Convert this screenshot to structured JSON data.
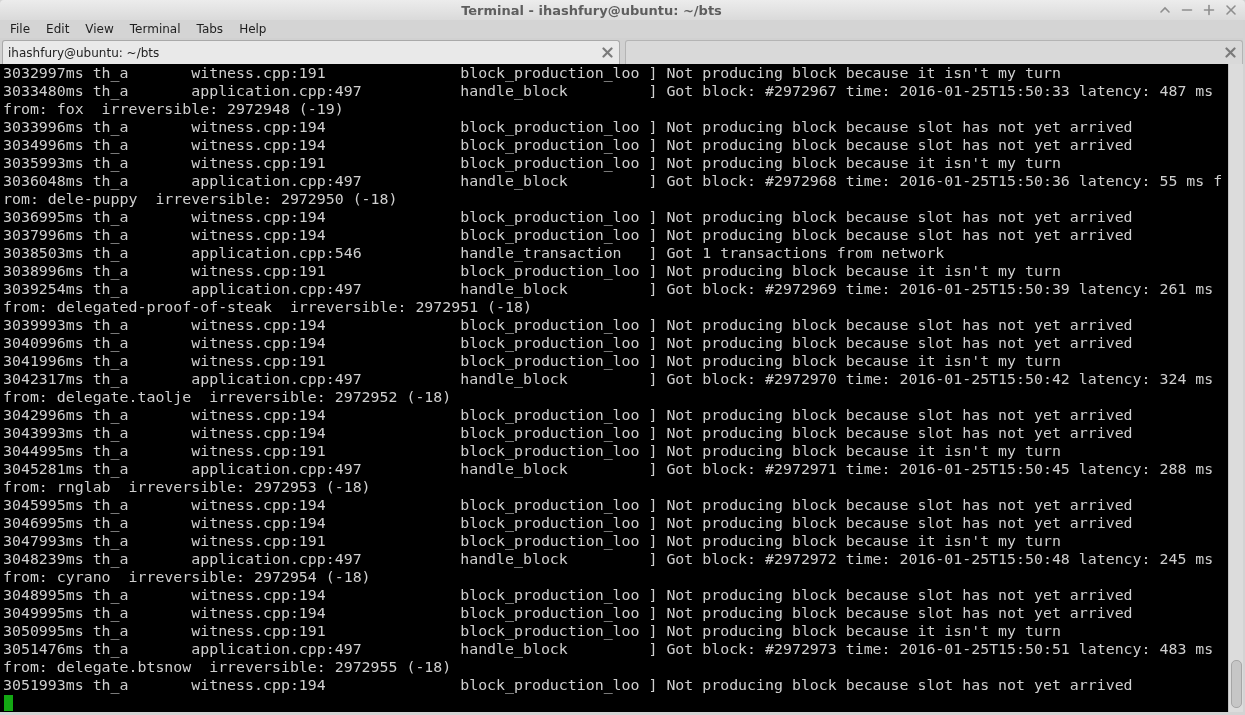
{
  "window": {
    "title": "Terminal - ihashfury@ubuntu: ~/bts"
  },
  "menu": [
    "File",
    "Edit",
    "View",
    "Terminal",
    "Tabs",
    "Help"
  ],
  "tabs": [
    {
      "label": "ihashfury@ubuntu: ~/bts",
      "selected": true
    },
    {
      "selected": false
    }
  ],
  "terminal": {
    "lines": [
      "3032997ms th_a       witness.cpp:191               block_production_loo ] Not producing block because it isn't my turn",
      "3033480ms th_a       application.cpp:497           handle_block         ] Got block: #2972967 time: 2016-01-25T15:50:33 latency: 487 ms",
      "from: fox  irreversible: 2972948 (-19)",
      "3033996ms th_a       witness.cpp:194               block_production_loo ] Not producing block because slot has not yet arrived",
      "3034996ms th_a       witness.cpp:194               block_production_loo ] Not producing block because slot has not yet arrived",
      "3035993ms th_a       witness.cpp:191               block_production_loo ] Not producing block because it isn't my turn",
      "3036048ms th_a       application.cpp:497           handle_block         ] Got block: #2972968 time: 2016-01-25T15:50:36 latency: 55 ms f",
      "rom: dele-puppy  irreversible: 2972950 (-18)",
      "3036995ms th_a       witness.cpp:194               block_production_loo ] Not producing block because slot has not yet arrived",
      "3037996ms th_a       witness.cpp:194               block_production_loo ] Not producing block because slot has not yet arrived",
      "3038503ms th_a       application.cpp:546           handle_transaction   ] Got 1 transactions from network",
      "3038996ms th_a       witness.cpp:191               block_production_loo ] Not producing block because it isn't my turn",
      "3039254ms th_a       application.cpp:497           handle_block         ] Got block: #2972969 time: 2016-01-25T15:50:39 latency: 261 ms",
      "from: delegated-proof-of-steak  irreversible: 2972951 (-18)",
      "3039993ms th_a       witness.cpp:194               block_production_loo ] Not producing block because slot has not yet arrived",
      "3040996ms th_a       witness.cpp:194               block_production_loo ] Not producing block because slot has not yet arrived",
      "3041996ms th_a       witness.cpp:191               block_production_loo ] Not producing block because it isn't my turn",
      "3042317ms th_a       application.cpp:497           handle_block         ] Got block: #2972970 time: 2016-01-25T15:50:42 latency: 324 ms",
      "from: delegate.taolje  irreversible: 2972952 (-18)",
      "3042996ms th_a       witness.cpp:194               block_production_loo ] Not producing block because slot has not yet arrived",
      "3043993ms th_a       witness.cpp:194               block_production_loo ] Not producing block because slot has not yet arrived",
      "3044995ms th_a       witness.cpp:191               block_production_loo ] Not producing block because it isn't my turn",
      "3045281ms th_a       application.cpp:497           handle_block         ] Got block: #2972971 time: 2016-01-25T15:50:45 latency: 288 ms",
      "from: rnglab  irreversible: 2972953 (-18)",
      "3045995ms th_a       witness.cpp:194               block_production_loo ] Not producing block because slot has not yet arrived",
      "3046995ms th_a       witness.cpp:194               block_production_loo ] Not producing block because slot has not yet arrived",
      "3047993ms th_a       witness.cpp:191               block_production_loo ] Not producing block because it isn't my turn",
      "3048239ms th_a       application.cpp:497           handle_block         ] Got block: #2972972 time: 2016-01-25T15:50:48 latency: 245 ms",
      "from: cyrano  irreversible: 2972954 (-18)",
      "3048995ms th_a       witness.cpp:194               block_production_loo ] Not producing block because slot has not yet arrived",
      "3049995ms th_a       witness.cpp:194               block_production_loo ] Not producing block because slot has not yet arrived",
      "3050995ms th_a       witness.cpp:191               block_production_loo ] Not producing block because it isn't my turn",
      "3051476ms th_a       application.cpp:497           handle_block         ] Got block: #2972973 time: 2016-01-25T15:50:51 latency: 483 ms",
      "from: delegate.btsnow  irreversible: 2972955 (-18)",
      "3051993ms th_a       witness.cpp:194               block_production_loo ] Not producing block because slot has not yet arrived"
    ]
  }
}
